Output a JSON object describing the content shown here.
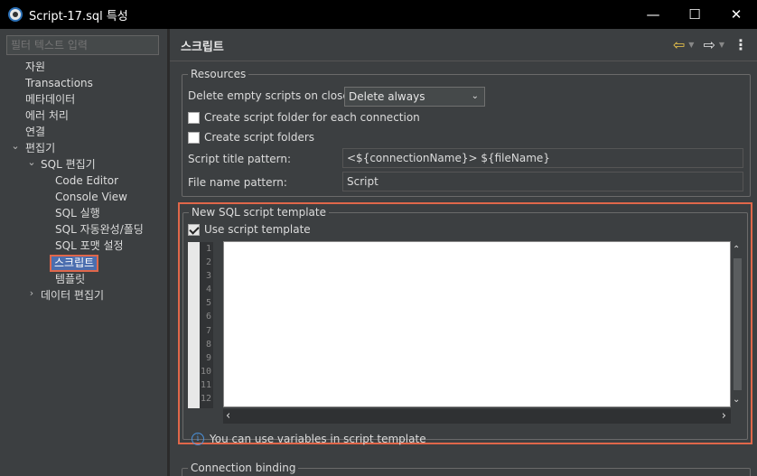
{
  "window": {
    "title": "Script-17.sql 특성",
    "minimize": "—",
    "maximize": "☐",
    "close": "✕"
  },
  "left": {
    "filter_placeholder": "필터 텍스트 입력",
    "tree": [
      {
        "label": "자원"
      },
      {
        "label": "Transactions"
      },
      {
        "label": "메타데이터"
      },
      {
        "label": "에러 처리"
      },
      {
        "label": "연결"
      },
      {
        "label": "편집기",
        "arrow": "⌄"
      },
      {
        "label": "SQL 편집기",
        "arrow": "⌄"
      },
      {
        "label": "Code Editor"
      },
      {
        "label": "Console View"
      },
      {
        "label": "SQL 실행"
      },
      {
        "label": "SQL 자동완성/폴딩"
      },
      {
        "label": "SQL 포맷 설정"
      },
      {
        "label": "스크립트",
        "selected": true
      },
      {
        "label": "템플릿"
      },
      {
        "label": "데이터 편집기",
        "arrow": "›"
      }
    ]
  },
  "page": {
    "title": "스크립트",
    "icons": {
      "back": "back-arrow-icon",
      "forward": "forward-arrow-icon",
      "menu": "kebab-menu-icon"
    }
  },
  "resources": {
    "legend": "Resources",
    "delete_label": "Delete empty scripts on close:",
    "delete_value": "Delete always",
    "create_per_connection": "Create script folder for each connection",
    "create_folders": "Create script folders",
    "title_pattern_label": "Script title pattern:",
    "title_pattern_value": "<${connectionName}> ${fileName}",
    "file_name_label": "File name pattern:",
    "file_name_value": "Script"
  },
  "template": {
    "legend": "New SQL script template",
    "use_template": "Use script template",
    "use_template_checked": true,
    "line_numbers": [
      "1",
      "2",
      "3",
      "4",
      "5",
      "6",
      "7",
      "8",
      "9",
      "10",
      "11",
      "12"
    ],
    "info": "You can use variables in script template"
  },
  "binding": {
    "legend": "Connection binding"
  },
  "colors": {
    "accent_highlight": "#e0674a",
    "selection": "#4b6eaf",
    "info_blue": "#4a90d9",
    "nav_arrow": "#f2c94c"
  }
}
